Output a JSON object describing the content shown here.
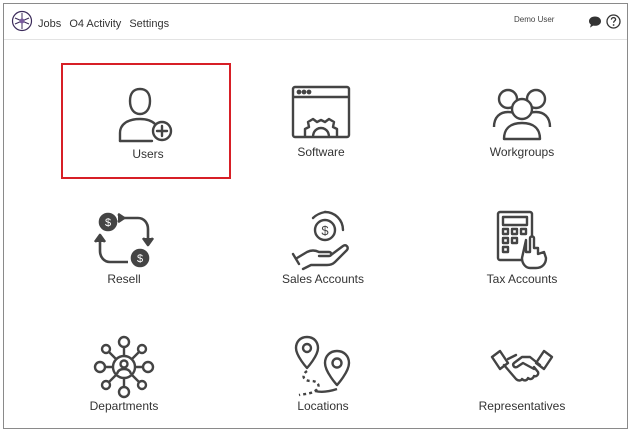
{
  "header": {
    "nav": [
      "Jobs",
      "O4 Activity",
      "Settings"
    ],
    "user": "Demo User",
    "icons": [
      "logo-icon",
      "chat-icon",
      "help-icon"
    ]
  },
  "tiles": [
    {
      "label": "Users",
      "icon": "user-add-icon",
      "selected": true
    },
    {
      "label": "Software",
      "icon": "software-gear-icon"
    },
    {
      "label": "Workgroups",
      "icon": "group-icon"
    },
    {
      "label": "Resell",
      "icon": "resell-cycle-icon"
    },
    {
      "label": "Sales Accounts",
      "icon": "sales-hand-coin-icon"
    },
    {
      "label": "Tax Accounts",
      "icon": "calculator-hand-icon"
    },
    {
      "label": "Departments",
      "icon": "network-person-icon"
    },
    {
      "label": "Locations",
      "icon": "map-pin-route-icon"
    },
    {
      "label": "Representatives",
      "icon": "handshake-icon"
    }
  ],
  "colors": {
    "selection_border": "#d71f26",
    "icon_stroke": "#444444"
  }
}
